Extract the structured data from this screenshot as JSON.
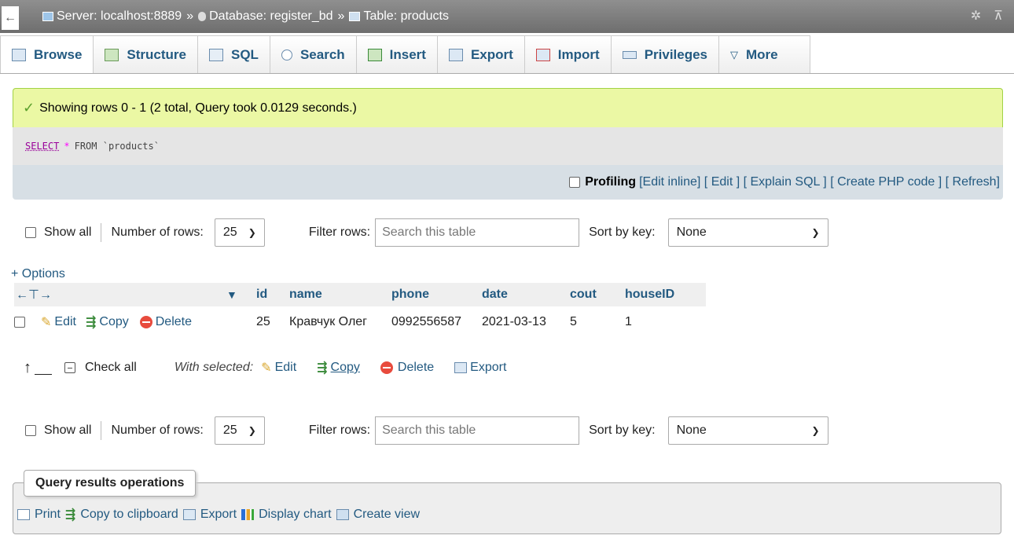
{
  "breadcrumb": {
    "server": "Server: localhost:8889",
    "database": "Database: register_bd",
    "table": "Table: products",
    "separator": "»"
  },
  "tabs": [
    {
      "label": "Browse",
      "icon": "browse-icon"
    },
    {
      "label": "Structure",
      "icon": "structure-icon"
    },
    {
      "label": "SQL",
      "icon": "sql-icon"
    },
    {
      "label": "Search",
      "icon": "search-icon"
    },
    {
      "label": "Insert",
      "icon": "insert-icon"
    },
    {
      "label": "Export",
      "icon": "export-icon"
    },
    {
      "label": "Import",
      "icon": "import-icon"
    },
    {
      "label": "Privileges",
      "icon": "privileges-icon"
    },
    {
      "label": "More",
      "icon": "chevron-down-icon"
    }
  ],
  "message": {
    "success": "Showing rows 0 - 1 (2 total, Query took 0.0129 seconds.)"
  },
  "query": {
    "keyword": "SELECT",
    "star": "*",
    "rest": "FROM `products`"
  },
  "query_tools": {
    "profiling": "Profiling",
    "edit_inline": "[Edit inline]",
    "edit": "[ Edit ]",
    "explain": "[ Explain SQL ]",
    "create_php": "[ Create PHP code ]",
    "refresh": "[ Refresh]"
  },
  "nav": {
    "show_all": "Show all",
    "number_of_rows_label": "Number of rows:",
    "rows_value": "25",
    "filter_label": "Filter rows:",
    "filter_placeholder": "Search this table",
    "sort_label": "Sort by key:",
    "sort_value": "None"
  },
  "options_label": "+ Options",
  "table": {
    "columns": [
      "id",
      "name",
      "phone",
      "date",
      "cout",
      "houseID"
    ],
    "rows": [
      {
        "id": "25",
        "name": "Кравчук Олег",
        "phone": "0992556587",
        "date": "2021-03-13",
        "cout": "5",
        "houseID": "1"
      }
    ],
    "row_actions": {
      "edit": "Edit",
      "copy": "Copy",
      "delete": "Delete"
    }
  },
  "bulk": {
    "check_all": "Check all",
    "with_selected": "With selected:",
    "edit": "Edit",
    "copy": "Copy",
    "delete": "Delete",
    "export": "Export"
  },
  "operations": {
    "legend": "Query results operations",
    "print": "Print",
    "copy_clipboard": "Copy to clipboard",
    "export": "Export",
    "display_chart": "Display chart",
    "create_view": "Create view"
  }
}
